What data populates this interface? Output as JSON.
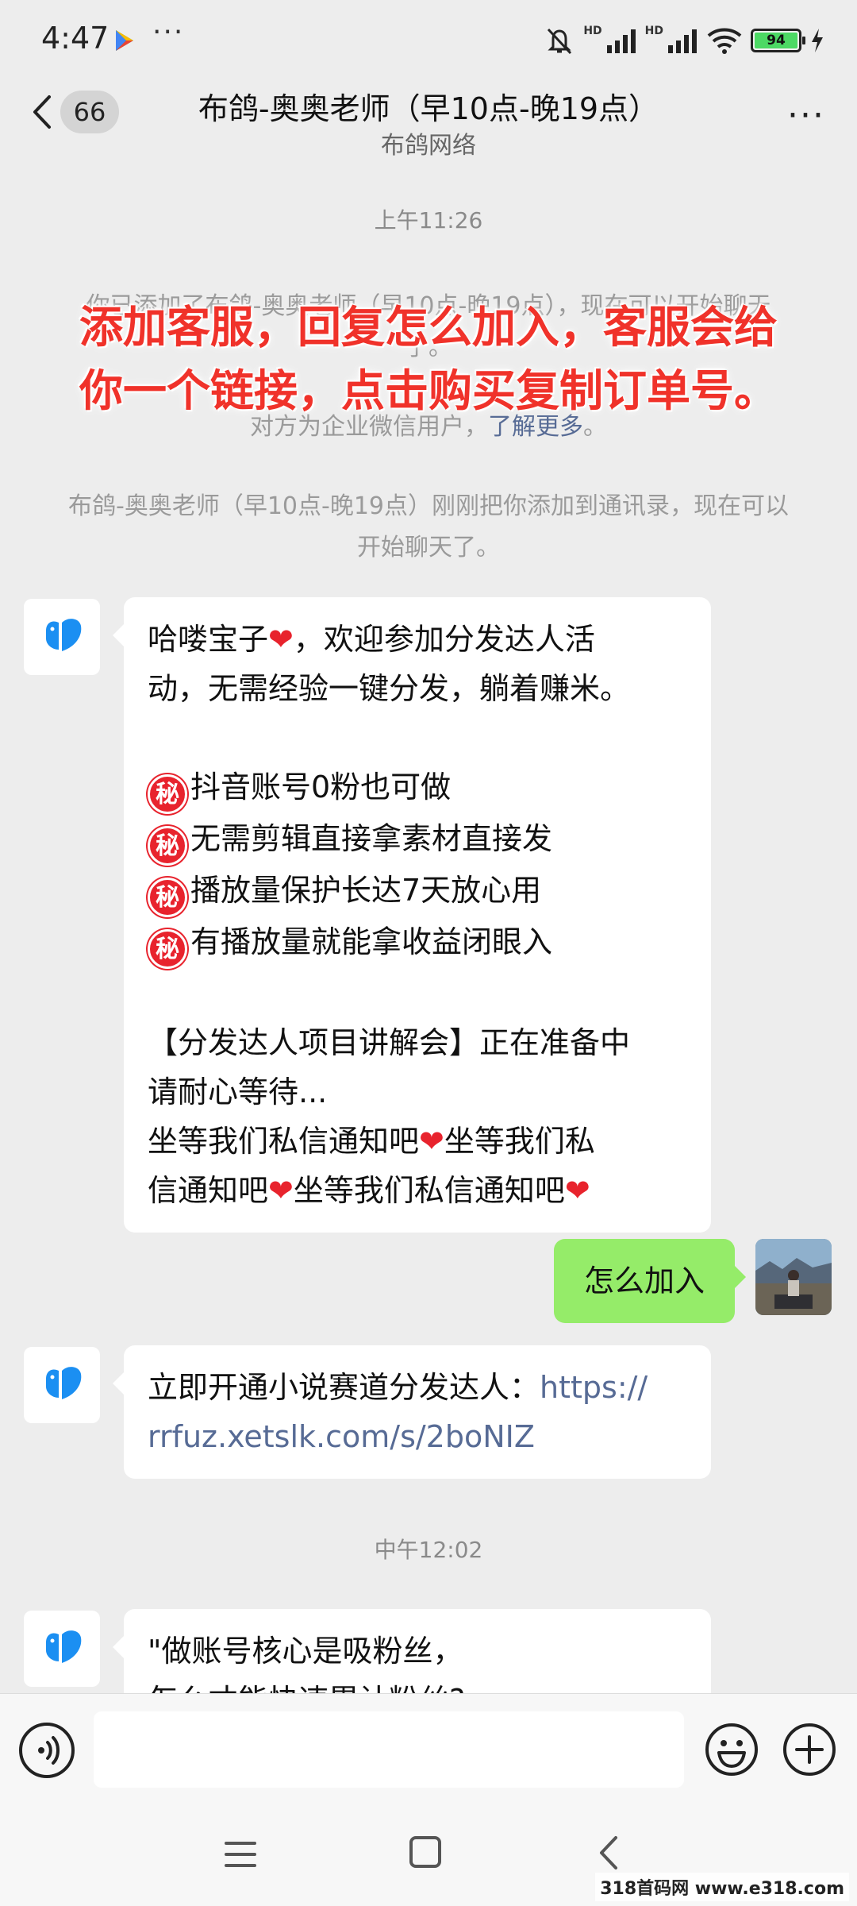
{
  "status": {
    "time": "4:47",
    "more": "···",
    "hd1": "HD",
    "hd2": "HD",
    "battery": "94"
  },
  "header": {
    "unread_count": "66",
    "title": "布鸽-奥奥老师（早10点-晚19点）",
    "subtitle": "布鸽网络",
    "more": "···"
  },
  "chat": {
    "time1": "上午11:26",
    "sys_added": "你已添加了布鸽-奥奥老师（早10点-晚19点），现在可以开始聊天了。",
    "sys_enterprise": "对方为企业微信用户，",
    "sys_enterprise_link": "了解更多",
    "sys_enterprise_end": "。",
    "sys_contact": "布鸽-奥奥老师（早10点-晚19点）刚刚把你添加到通讯录，现在可以开始聊天了。",
    "overlay": "添加客服，回复怎么加入，客服会给你一个链接，点击购买复制订单号。",
    "msg1": {
      "l1": "哈喽宝子",
      "l1b": "，欢迎参加分发达人活",
      "l2": "动，无需经验一键分发，躺着赚米。",
      "badge": "秘",
      "b1": "抖音账号0粉也可做",
      "b2": "无需剪辑直接拿素材直接发",
      "b3": "播放量保护长达7天放心用",
      "b4": "有播放量就能拿收益闭眼入",
      "l3": "【分发达人项目讲解会】正在准备中",
      "l4": "请耐心等待...",
      "l5": "坐等我们私信通知吧",
      "l5b": "坐等我们私",
      "l6": "信通知吧",
      "l6b": "坐等我们私信通知吧",
      "heart": "❤"
    },
    "msg2": "怎么加入",
    "msg3": {
      "text": "立即开通小说赛道分发达人：",
      "link1": "https://",
      "link2": "rrfuz.xetslk.com/s/2boNIZ"
    },
    "time2": "中午12:02",
    "msg4": {
      "l1": "\"做账号核心是吸粉丝，",
      "l2": "怎么才能快速累计粉丝?"
    }
  },
  "watermark": "318首码网 www.e318.com"
}
